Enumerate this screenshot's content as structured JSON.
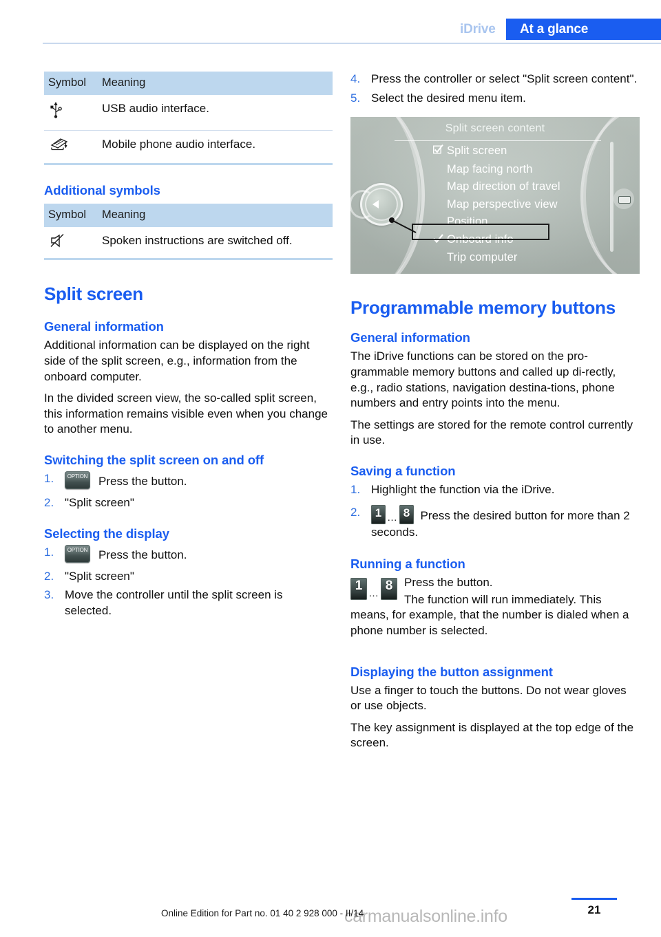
{
  "header": {
    "breadcrumb": "iDrive",
    "title": "At a glance"
  },
  "left_column": {
    "table1": {
      "headers": [
        "Symbol",
        "Meaning"
      ],
      "rows": [
        {
          "icon": "usb-icon",
          "meaning": "USB audio interface."
        },
        {
          "icon": "mobile-phone-audio-icon",
          "meaning": "Mobile phone audio interface."
        }
      ]
    },
    "additional_symbols_heading": "Additional symbols",
    "table2": {
      "headers": [
        "Symbol",
        "Meaning"
      ],
      "rows": [
        {
          "icon": "muted-speaker-icon",
          "meaning": "Spoken instructions are switched off."
        }
      ]
    },
    "split_screen": {
      "title": "Split screen",
      "general_information": {
        "heading": "General information",
        "paragraphs": [
          "Additional information can be displayed on the right side of the split screen, e.g., information from the onboard computer.",
          "In the divided screen view, the so-called split screen, this information remains visible even when you change to another menu."
        ]
      },
      "switching": {
        "heading": "Switching the split screen on and off",
        "steps": [
          {
            "num": "1.",
            "button": "OPTION",
            "text": "Press the button."
          },
          {
            "num": "2.",
            "text": "\"Split screen\""
          }
        ]
      },
      "selecting": {
        "heading": "Selecting the display",
        "steps": [
          {
            "num": "1.",
            "button": "OPTION",
            "text": "Press the button."
          },
          {
            "num": "2.",
            "text": "\"Split screen\""
          },
          {
            "num": "3.",
            "text": "Move the controller until the split screen is selected."
          }
        ]
      }
    }
  },
  "right_column": {
    "steps_continued": [
      {
        "num": "4.",
        "text": "Press the controller or select \"Split screen content\"."
      },
      {
        "num": "5.",
        "text": "Select the desired menu item."
      }
    ],
    "idrive_screen": {
      "title": "Split screen content",
      "menu_items": [
        {
          "label": "Split screen",
          "mark": "checkbox-checked",
          "highlighted": false
        },
        {
          "label": "Map facing north",
          "mark": "",
          "highlighted": false
        },
        {
          "label": "Map direction of travel",
          "mark": "",
          "highlighted": false
        },
        {
          "label": "Map perspective view",
          "mark": "",
          "highlighted": false
        },
        {
          "label": "Position",
          "mark": "",
          "highlighted": false
        },
        {
          "label": "Onboard info",
          "mark": "check",
          "highlighted": true
        },
        {
          "label": "Trip computer",
          "mark": "",
          "highlighted": false
        }
      ]
    },
    "memory_buttons": {
      "title": "Programmable memory buttons",
      "general_information": {
        "heading": "General information",
        "paragraphs": [
          "The iDrive functions can be stored on the pro‐grammable memory buttons and called up di‐rectly, e.g., radio stations, navigation destina‐tions, phone numbers and entry points into the menu.",
          "The settings are stored for the remote control currently in use."
        ]
      },
      "saving": {
        "heading": "Saving a function",
        "steps": [
          {
            "num": "1.",
            "text": "Highlight the function via the iDrive."
          },
          {
            "num": "2.",
            "button_from": "1",
            "button_to": "8",
            "text": "Press the desired button for more than 2 seconds."
          }
        ]
      },
      "running": {
        "heading": "Running a function",
        "button_from": "1",
        "button_to": "8",
        "line1": "Press the button.",
        "line2": "The function will run immediately. This means, for example, that the number is dialed when a phone number is selected."
      },
      "displaying": {
        "heading": "Displaying the button assignment",
        "paragraphs": [
          "Use a finger to touch the buttons. Do not wear gloves or use objects.",
          "The key assignment is displayed at the top edge of the screen."
        ]
      }
    }
  },
  "footer": {
    "edition_text": "Online Edition for Part no. 01 40 2 928 000 - II/14",
    "page_number": "21",
    "watermark": "carmanualsonline.info"
  },
  "colors": {
    "accent_blue": "#1a5df0",
    "header_sub": "#a9c5ef",
    "table_header_bg": "#bdd7ee",
    "idrive_bg": "#b9c3bd"
  }
}
